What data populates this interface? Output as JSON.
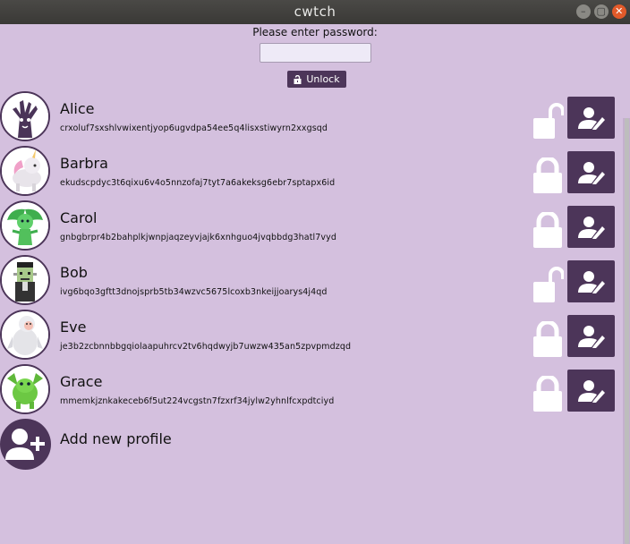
{
  "window": {
    "title": "cwtch",
    "controls": {
      "minimize": "–",
      "maximize": "▢",
      "close": "✕"
    }
  },
  "login": {
    "label": "Please enter password:",
    "password_value": "",
    "password_placeholder": "",
    "unlock_label": "Unlock"
  },
  "profiles": [
    {
      "name": "Alice",
      "onion": "crxoluf7sxshlvwixentjyop6ugvdpa54ee5q4lisxstiwyrn2xxgsqd",
      "lock": "unlocked",
      "avatar": "tree"
    },
    {
      "name": "Barbra",
      "onion": "ekudscpdyc3t6qixu6v4o5nnzofaj7tyt7a6akeksg6ebr7sptapx6id",
      "lock": "locked",
      "avatar": "unicorn"
    },
    {
      "name": "Carol",
      "onion": "gnbgbrpr4b2bahplkjwnpjaqzeyvjajk6xnhguo4jvqbbdg3hatl7vyd",
      "lock": "locked",
      "avatar": "plant"
    },
    {
      "name": "Bob",
      "onion": "ivg6bqo3gftt3dnojsprb5tb34wzvc5675lcoxb3nkeijjoarys4j4qd",
      "lock": "unlocked",
      "avatar": "frankenstein"
    },
    {
      "name": "Eve",
      "onion": "je3b2zcbnnbbgqiolaapuhrcv2tv6hqdwyjb7uwzw435an5zpvpmdzqd",
      "lock": "locked",
      "avatar": "yeti"
    },
    {
      "name": "Grace",
      "onion": "mmemkjznkakeceb6f5ut224vcgstn7fzxrf34jylw2yhnlfcxpdtciyd",
      "lock": "locked",
      "avatar": "dragon"
    }
  ],
  "add_profile": {
    "label": "Add new profile"
  },
  "colors": {
    "background": "#d4c0de",
    "accent": "#4c3559",
    "lock_icon": "#ffffff"
  }
}
